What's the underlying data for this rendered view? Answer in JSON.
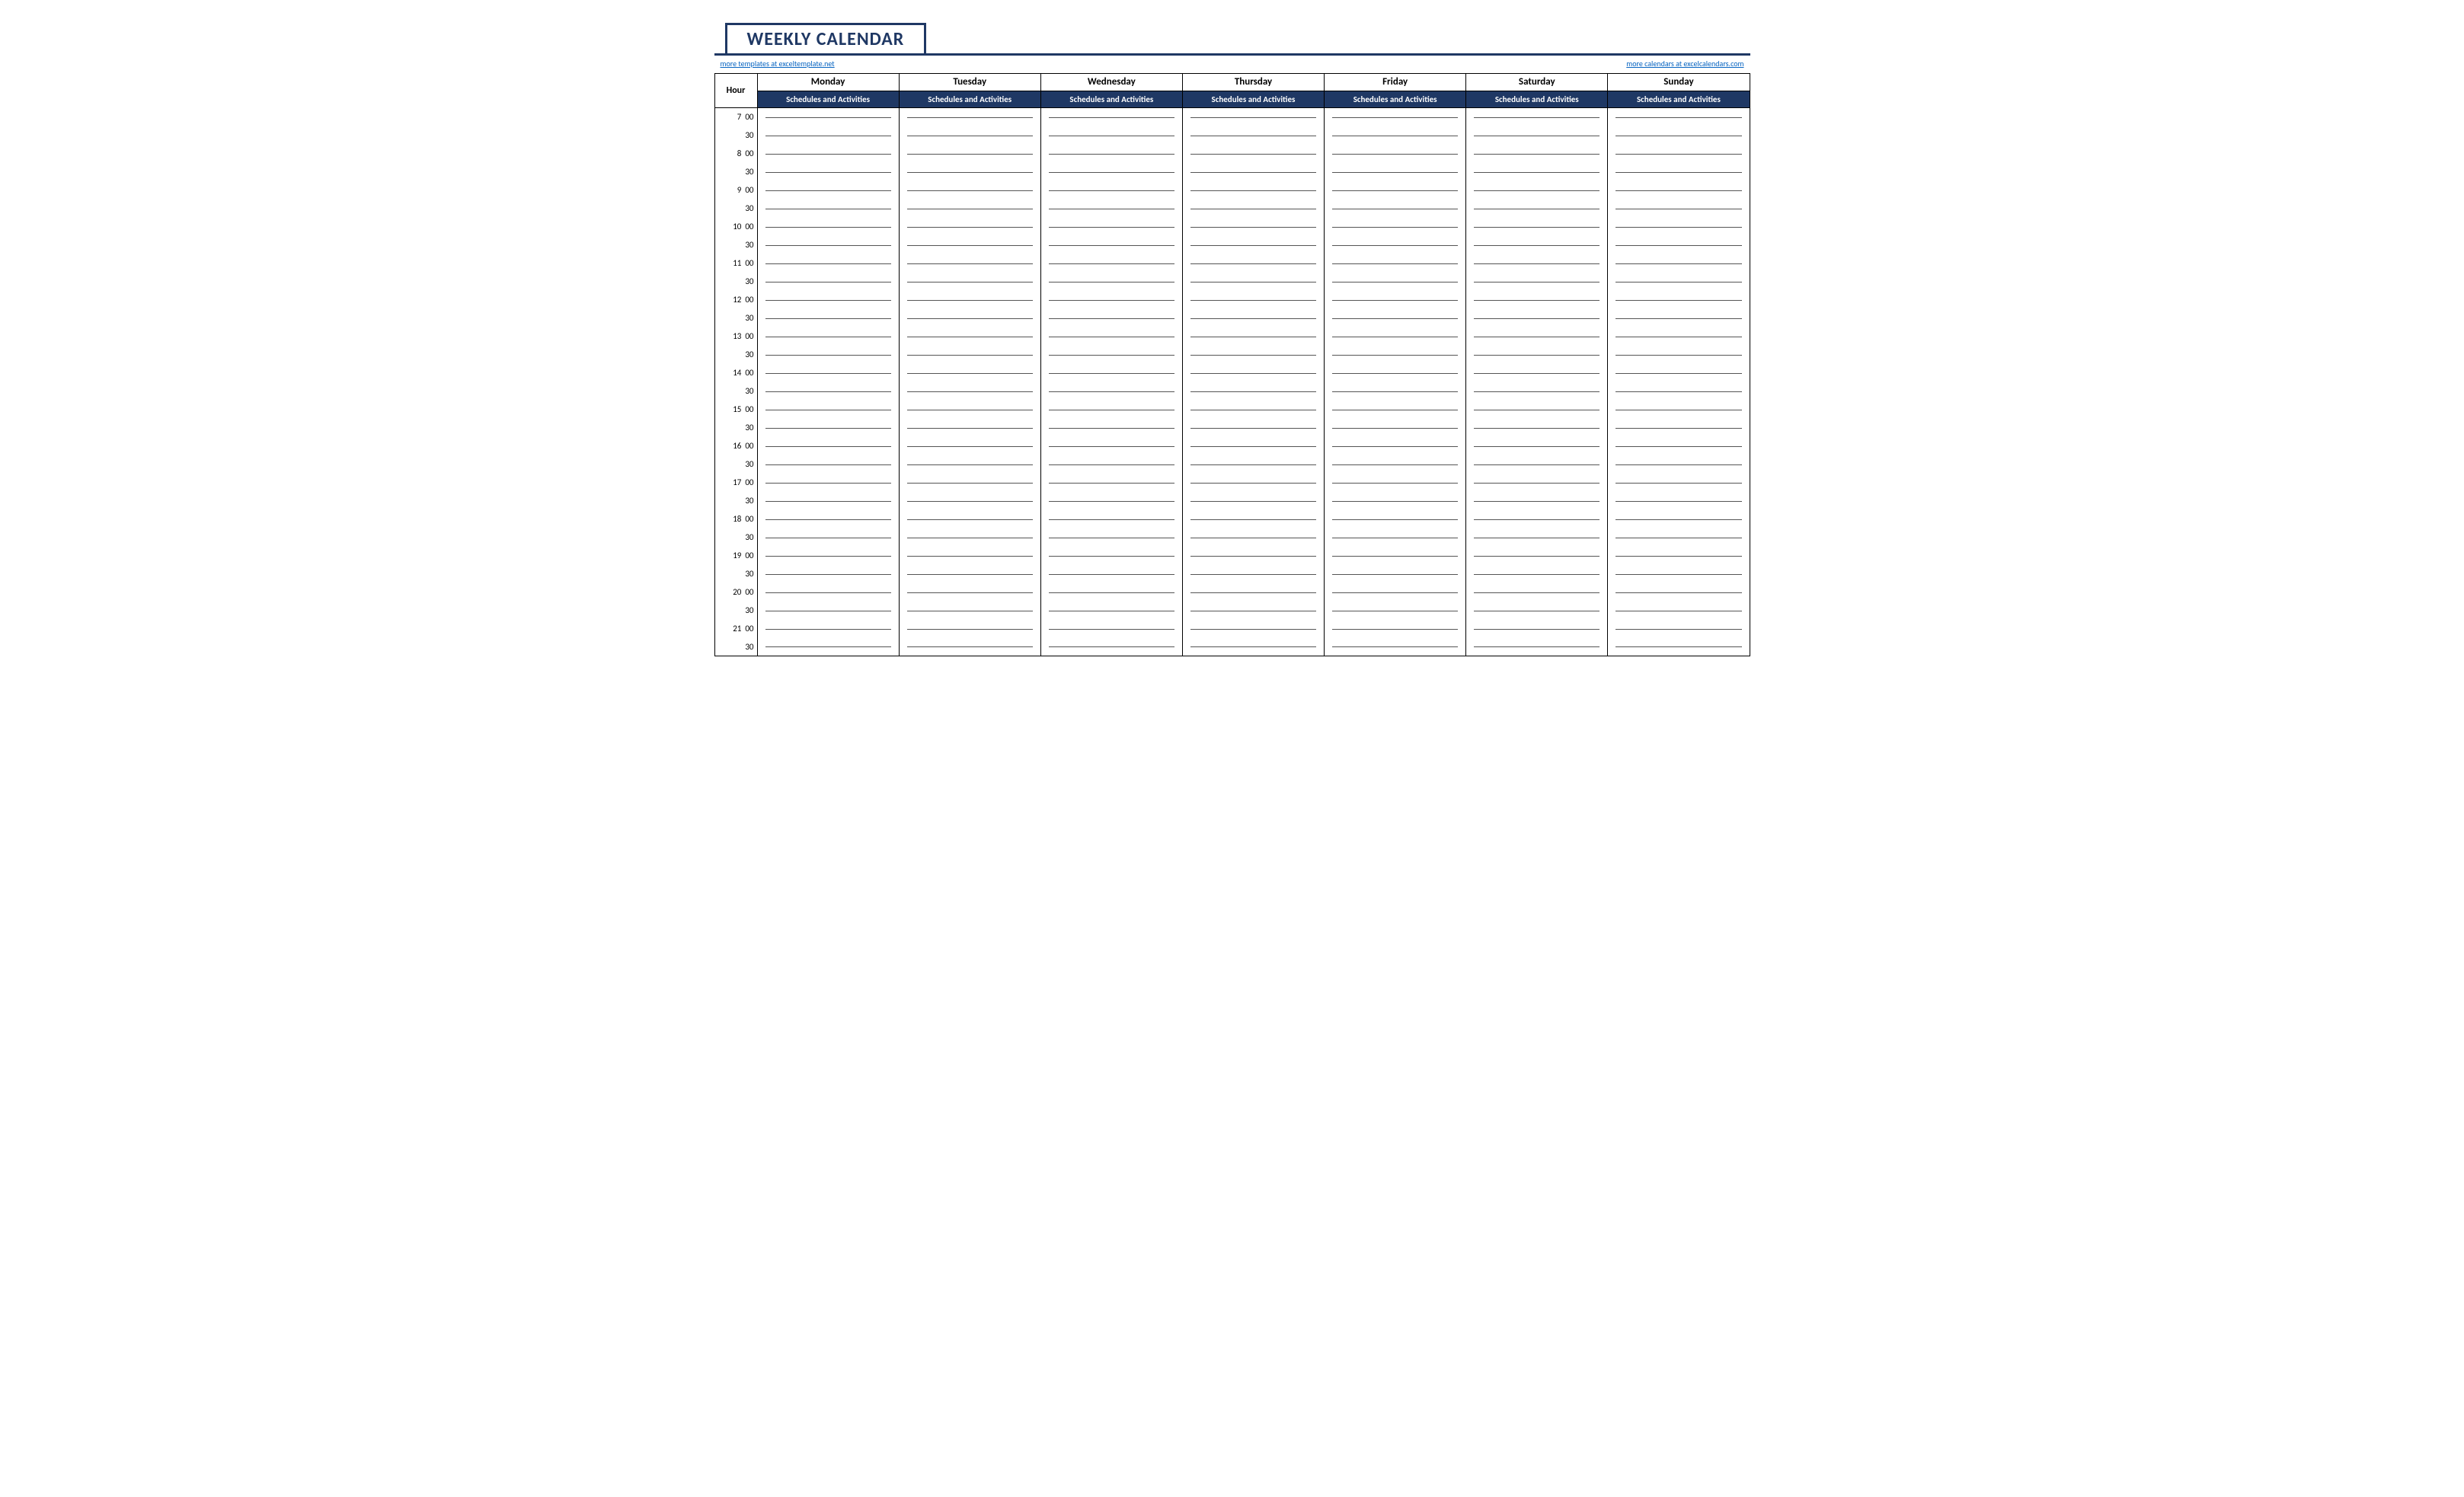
{
  "title": "WEEKLY CALENDAR",
  "link_left": "more templates at exceltemplate.net",
  "link_right": "more calendars at excelcalendars.com",
  "hour_header": "Hour",
  "days": [
    "Monday",
    "Tuesday",
    "Wednesday",
    "Thursday",
    "Friday",
    "Saturday",
    "Sunday"
  ],
  "sub_header": "Schedules and Activities",
  "time_slots": [
    "7  00",
    "30",
    "8  00",
    "30",
    "9  00",
    "30",
    "10  00",
    "30",
    "11  00",
    "30",
    "12  00",
    "30",
    "13  00",
    "30",
    "14  00",
    "30",
    "15  00",
    "30",
    "16  00",
    "30",
    "17  00",
    "30",
    "18  00",
    "30",
    "19  00",
    "30",
    "20  00",
    "30",
    "21  00",
    "30"
  ]
}
